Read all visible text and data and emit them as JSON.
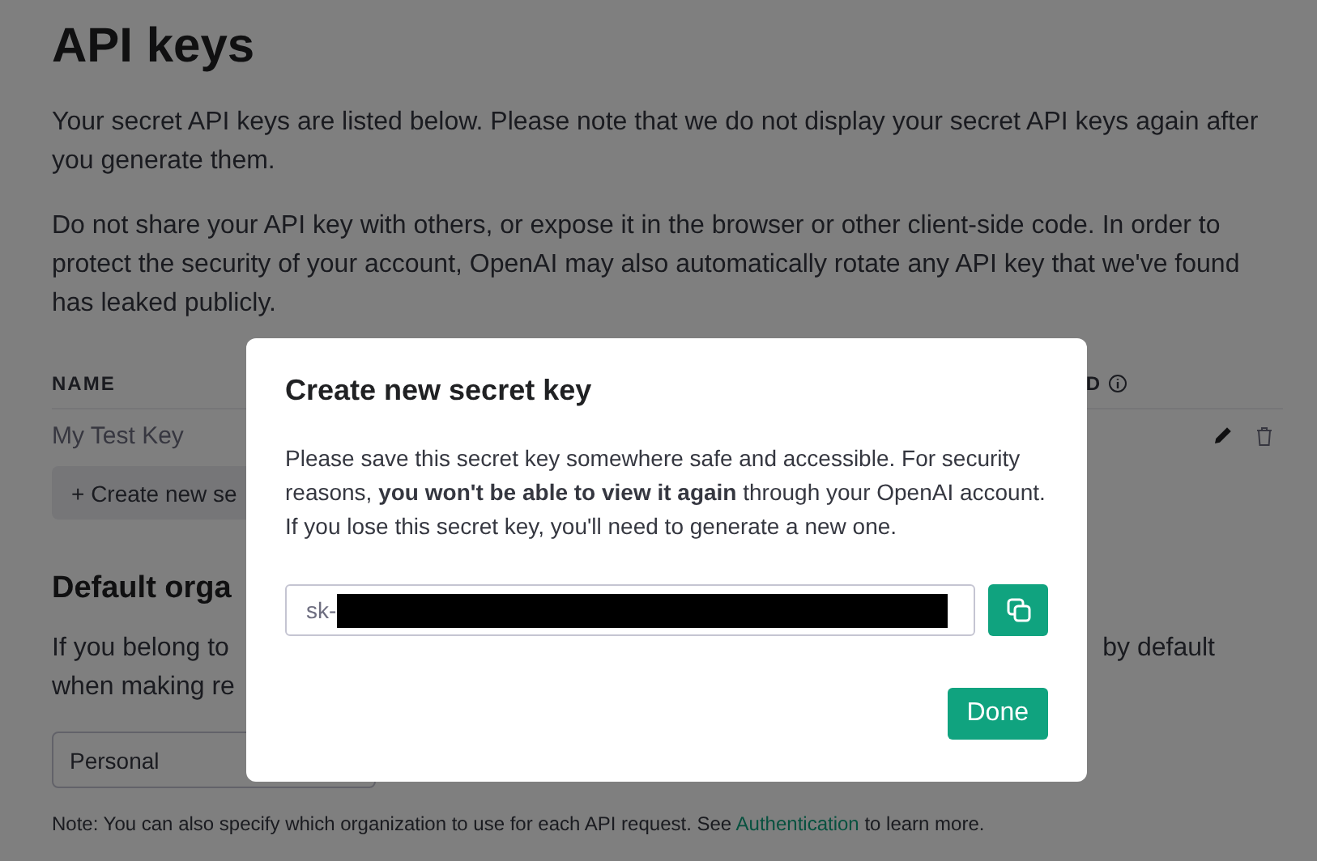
{
  "page": {
    "title": "API keys",
    "paragraphs": [
      "Your secret API keys are listed below. Please note that we do not display your secret API keys again after you generate them.",
      "Do not share your API key with others, or expose it in the browser or other client-side code. In order to protect the security of your account, OpenAI may also automatically rotate any API key that we've found has leaked publicly."
    ],
    "table": {
      "columns": [
        "NAME",
        "D"
      ],
      "rows": [
        {
          "name": "My Test Key"
        }
      ]
    },
    "create_button": "+ Create new se",
    "org_heading": "Default orga",
    "org_lines": [
      {
        "left": "If you belong to",
        "right": "by default"
      },
      {
        "left": "when making re"
      }
    ],
    "org_select": {
      "value": "Personal"
    },
    "note": {
      "text": "Note: You can also specify which organization to use for each API request. See",
      "link": "Authentication",
      "after": "to learn more."
    }
  },
  "dialog": {
    "title": "Create new secret key",
    "message": "Please save this secret key somewhere safe and accessible. For security reasons, **you won't be able to view it again** through your OpenAI account. If you lose this secret key, you'll need to generate a new one.",
    "key_prefix": "sk-",
    "button": "Done"
  }
}
